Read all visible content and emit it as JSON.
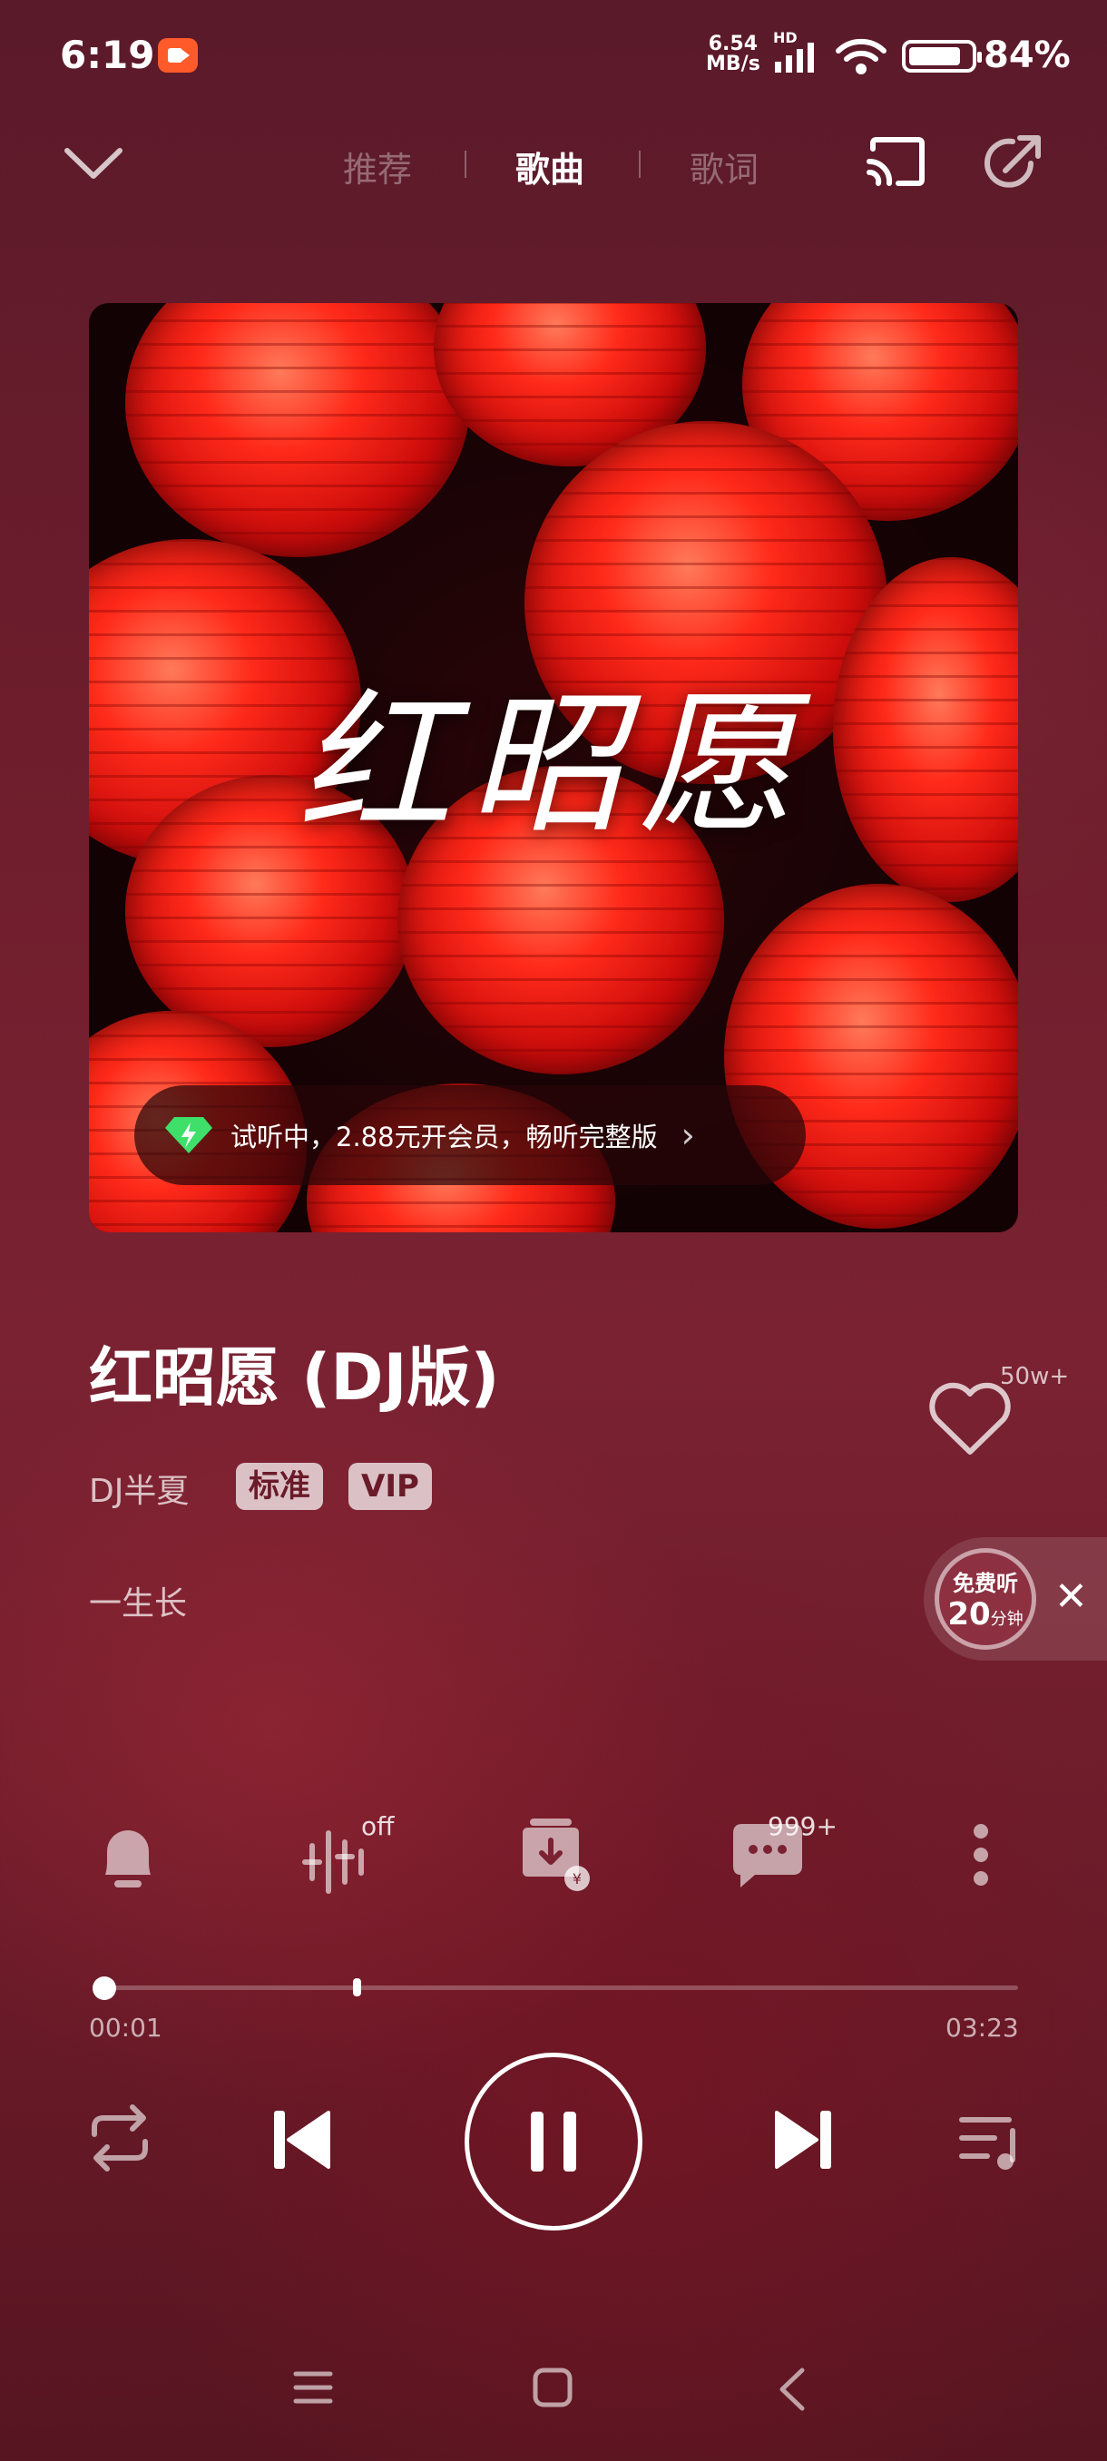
{
  "status_bar": {
    "time": "6:19",
    "net_speed_value": "6.54",
    "net_speed_unit": "MB/s",
    "net_type": "HD",
    "battery_percent": "84%"
  },
  "header": {
    "tabs": [
      {
        "label": "推荐",
        "active": false
      },
      {
        "label": "歌曲",
        "active": true
      },
      {
        "label": "歌词",
        "active": false
      }
    ]
  },
  "album": {
    "cover_title": "红昭愿",
    "promo_text": "试听中，2.88元开会员，畅听完整版"
  },
  "song": {
    "title": "红昭愿 (DJ版)",
    "artist": "DJ半夏",
    "badges": [
      "标准",
      "VIP"
    ],
    "subtitle": "一生长",
    "like_count": "50w+"
  },
  "free_listen": {
    "label": "免费听",
    "minutes": "20",
    "unit": "分钟"
  },
  "actions": {
    "effect_badge": "off",
    "comment_badge": "999+"
  },
  "progress": {
    "current_time": "00:01",
    "total_time": "03:23",
    "played_fraction": 0.005,
    "buffered_fraction": 0.28
  },
  "colors": {
    "background": "#6e1d2c",
    "badge_bg": "#d9c5ca",
    "free_listen_ring": "#c9a0ac"
  }
}
